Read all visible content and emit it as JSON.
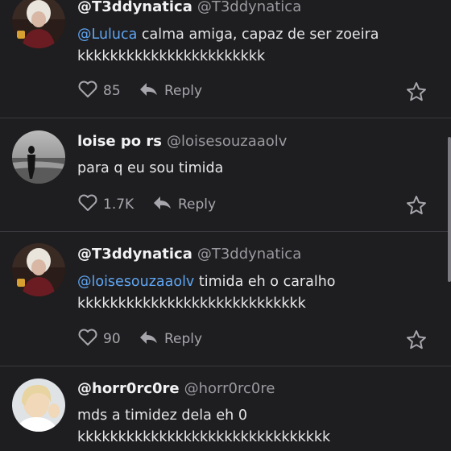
{
  "comments": [
    {
      "name": "@T3ddynatica",
      "handle": "@T3ddynatica",
      "mention": "@Luluca",
      "line1_text": " calma amiga, capaz de ser zoeira",
      "line2": "kkkkkkkkkkkkkkkkkkkkkkk",
      "likes": "85",
      "reply_label": "Reply"
    },
    {
      "name": "loise po rs",
      "handle": "@loisesouzaaolv",
      "line1_text": "para q eu sou timida",
      "likes": "1.7K",
      "reply_label": "Reply"
    },
    {
      "name": "@T3ddynatica",
      "handle": "@T3ddynatica",
      "mention": "@loisesouzaaolv",
      "line1_text": " timida eh o caralho",
      "line2": "kkkkkkkkkkkkkkkkkkkkkkkkkkkk",
      "likes": "90",
      "reply_label": "Reply"
    },
    {
      "name": "@horr0rc0re",
      "handle": "@horr0rc0re",
      "line1_text": "mds a timidez dela eh 0",
      "line2": "kkkkkkkkkkkkkkkkkkkkkkkkkkkkkkk"
    }
  ],
  "icons": {
    "like": "heart-icon",
    "reply": "reply-arrow-icon",
    "favorite": "star-icon"
  },
  "colors": {
    "background": "#1e1e20",
    "mention": "#5fa5f2",
    "divider": "#3a3a3e"
  }
}
